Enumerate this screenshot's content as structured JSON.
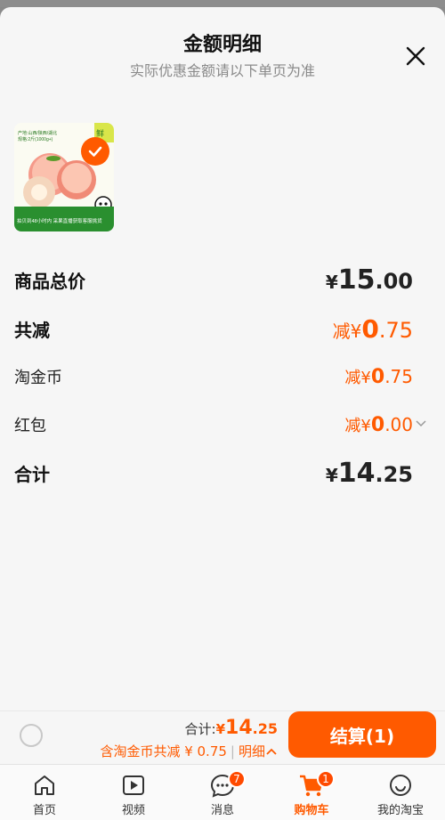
{
  "sheet": {
    "title": "金额明细",
    "subtitle": "实际优惠金额请以下单页为准"
  },
  "product": {
    "thumb_lines": [
      "产地:山西/陕西/湖北",
      "规格:2斤(1000g+)"
    ],
    "thumb_badge": "鲜",
    "thumb_caption": "拍贝到48小时内 采果直播获取客服挑货"
  },
  "details": [
    {
      "label": "商品总价",
      "prefix": "",
      "currency": "¥",
      "int": "15",
      "dec": ".00",
      "style": "black"
    },
    {
      "label": "共减",
      "prefix": "减",
      "currency": "¥",
      "int": "0",
      "dec": ".75",
      "style": "orange"
    },
    {
      "label": "淘金币",
      "prefix": "减",
      "currency": "¥",
      "int": "0",
      "dec": ".75",
      "style": "orange-small"
    },
    {
      "label": "红包",
      "prefix": "减",
      "currency": "¥",
      "int": "0",
      "dec": ".00",
      "style": "orange-small"
    },
    {
      "label": "合计",
      "prefix": "",
      "currency": "¥",
      "int": "14",
      "dec": ".25",
      "style": "black"
    }
  ],
  "bottom_bar": {
    "total_label": "合计:",
    "total_currency": "¥",
    "total_int": "14",
    "total_dec": ".25",
    "coin_text": "含淘金币共减 ¥ 0.75",
    "detail_label": "明细",
    "checkout_label": "结算(1)"
  },
  "tabs": [
    {
      "label": "首页",
      "icon": "home-icon",
      "badge": ""
    },
    {
      "label": "视频",
      "icon": "video-icon",
      "badge": ""
    },
    {
      "label": "消息",
      "icon": "message-icon",
      "badge": "7"
    },
    {
      "label": "购物车",
      "icon": "cart-icon",
      "badge": "1",
      "active": true
    },
    {
      "label": "我的淘宝",
      "icon": "profile-icon",
      "badge": ""
    }
  ],
  "colors": {
    "accent": "#ff5a00",
    "background": "#f6f6f6"
  }
}
